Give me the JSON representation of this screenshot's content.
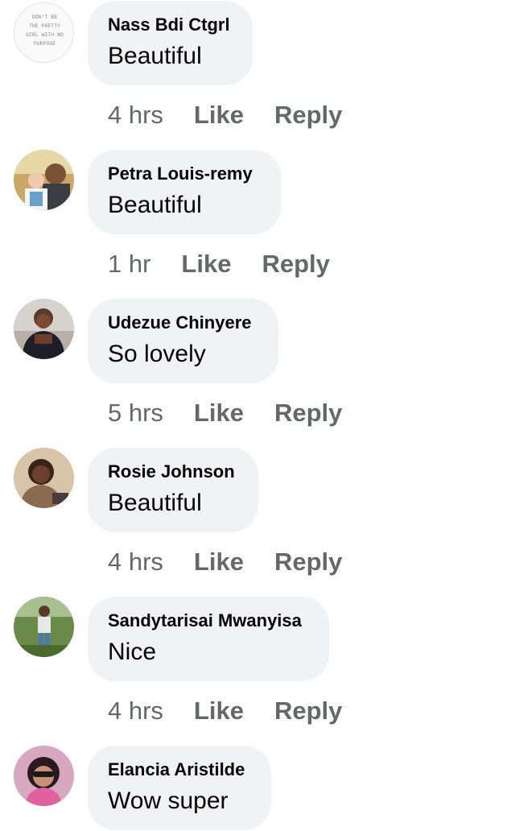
{
  "comments": [
    {
      "name": "Nass Bdi Ctgrl",
      "text": "Beautiful",
      "time": "4 hrs",
      "like": "Like",
      "reply": "Reply",
      "avatar_text": [
        "DON'T BE",
        "THE PRETTY",
        "GIRL WITH NO",
        "PURPOSE"
      ]
    },
    {
      "name": "Petra Louis-remy",
      "text": "Beautiful",
      "time": "1 hr",
      "like": "Like",
      "reply": "Reply"
    },
    {
      "name": "Udezue Chinyere",
      "text": "So lovely",
      "time": "5 hrs",
      "like": "Like",
      "reply": "Reply"
    },
    {
      "name": "Rosie Johnson",
      "text": "Beautiful",
      "time": "4 hrs",
      "like": "Like",
      "reply": "Reply"
    },
    {
      "name": "Sandytarisai Mwanyisa",
      "text": "Nice",
      "time": "4 hrs",
      "like": "Like",
      "reply": "Reply"
    },
    {
      "name": "Elancia Aristilde",
      "text": "Wow super"
    }
  ],
  "colors": {
    "bubble": "#f0f2f5",
    "name": "#050505",
    "meta": "#65676b"
  }
}
